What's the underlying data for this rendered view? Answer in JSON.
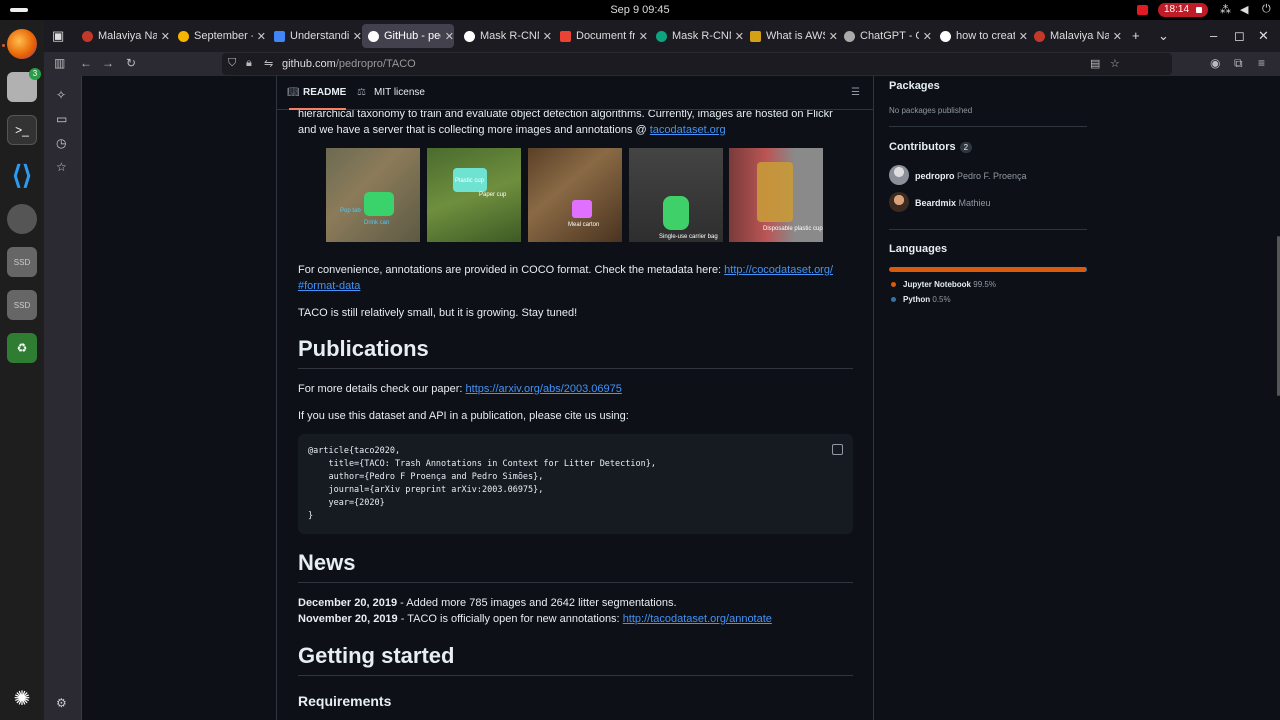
{
  "system": {
    "clock": "Sep 9  09:45",
    "recording_time": "18:14",
    "dock_badge": "3",
    "dock_labels": [
      "SSD",
      "SSD"
    ]
  },
  "browser": {
    "tabs": [
      {
        "label": "Malaviya Nat",
        "favicon": "globe-icon",
        "color": "#c0392b"
      },
      {
        "label": "September -",
        "favicon": "drive-icon",
        "color": "#f4b400"
      },
      {
        "label": "Understandi",
        "favicon": "doc-icon",
        "color": "#4285f4"
      },
      {
        "label": "GitHub - ped",
        "favicon": "github-icon",
        "color": "#ffffff",
        "active": true
      },
      {
        "label": "Mask R-CNN",
        "favicon": "google-icon",
        "color": "#ffffff"
      },
      {
        "label": "Document fr",
        "favicon": "gmail-icon",
        "color": "#ea4335"
      },
      {
        "label": "Mask R-CNN",
        "favicon": "chatgpt-icon",
        "color": "#10a37f"
      },
      {
        "label": "What is AWS",
        "favicon": "box-icon",
        "color": "#d4a017"
      },
      {
        "label": "ChatGPT - Co",
        "favicon": "chatgpt-icon",
        "color": "#aaaaaa"
      },
      {
        "label": "how to creat",
        "favicon": "google-icon",
        "color": "#ffffff"
      },
      {
        "label": "Malaviya Nat",
        "favicon": "globe-icon",
        "color": "#c0392b"
      }
    ],
    "url_host": "github.com",
    "url_path": "/pedropro/TACO"
  },
  "readme": {
    "tab_readme": "README",
    "tab_license": "MIT license",
    "intro_line1": "hierarchical taxonomy to train and evaluate object detection algorithms. Currently, images are hosted on Flickr",
    "intro_line2_pre": "and we have a server that is collecting more images and annotations @ ",
    "intro_link": "tacodataset.org",
    "image_labels": [
      [
        "Pop tab",
        "Drink can"
      ],
      [
        "Plastic cup",
        "Paper cup"
      ],
      [
        "Meal carton"
      ],
      [
        "Single-use carrier bag"
      ],
      [
        "Disposable plastic cup"
      ]
    ],
    "coco_pre": "For convenience, annotations are provided in COCO format. Check the metadata here: ",
    "coco_link1": "http://cocodataset.org/",
    "coco_link2": "#format-data",
    "small_text": "TACO is still relatively small, but it is growing. Stay tuned!",
    "publications_heading": "Publications",
    "paper_pre": "For more details check our paper: ",
    "paper_link": "https://arxiv.org/abs/2003.06975",
    "cite_text": "If you use this dataset and API in a publication, please cite us using:",
    "code_lines": [
      "@article{taco2020,",
      "    title={TACO: Trash Annotations in Context for Litter Detection},",
      "    author={Pedro F Proença and Pedro Simões},",
      "    journal={arXiv preprint arXiv:2003.06975},",
      "    year={2020}",
      "}"
    ],
    "news_heading": "News",
    "news1_date": "December 20, 2019",
    "news1_text": " - Added more 785 images and 2642 litter segmentations.",
    "news2_date": "November 20, 2019",
    "news2_text": " - TACO is officially open for new annotations: ",
    "news2_link": "http://tacodataset.org/annotate",
    "getting_started_heading": "Getting started",
    "requirements_heading": "Requirements"
  },
  "aside": {
    "packages_heading": "Packages",
    "packages_text": "No packages published",
    "contributors_heading": "Contributors",
    "contributors_count": "2",
    "contributors": [
      {
        "login": "pedropro",
        "name": "Pedro F. Proença"
      },
      {
        "login": "Beardmix",
        "name": "Mathieu"
      }
    ],
    "languages_heading": "Languages",
    "languages": [
      {
        "name": "Jupyter Notebook",
        "pct": "99.5%",
        "color": "#da5b0b"
      },
      {
        "name": "Python",
        "pct": "0.5%",
        "color": "#3572a5"
      }
    ]
  }
}
